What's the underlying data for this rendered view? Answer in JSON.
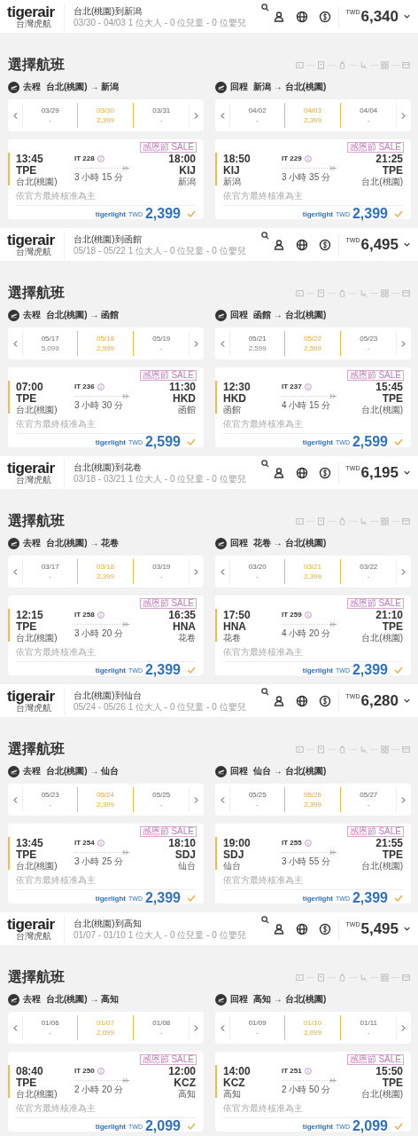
{
  "sections": [
    {
      "header": {
        "logo": "tigerair",
        "logo_subtitle": "台灣虎航",
        "route": "台北(桃園)到新潟",
        "details": "03/30 - 04/03  1 位大人 - 0 位兒童 - 0 位嬰兒",
        "currency": "TWD",
        "total": "6,340"
      },
      "title": "選擇航班",
      "legs": [
        {
          "label": "去程",
          "route": "台北(桃園) → 新潟",
          "dates": [
            {
              "date": "03/29",
              "price": "-",
              "selected": false
            },
            {
              "date": "03/30",
              "price": "2,399",
              "selected": true
            },
            {
              "date": "03/31",
              "price": "-",
              "selected": false
            }
          ],
          "flight": {
            "tag": "感恩節 SALE",
            "depart_time": "13:45",
            "depart_code": "TPE",
            "depart_city": "台北(桃園)",
            "flight_no": "IT 228",
            "duration": "3 小時 15 分",
            "arrive_time": "18:00",
            "arrive_code": "KIJ",
            "arrive_city": "新潟",
            "note": "依官方最終核准為主",
            "fare_brand": "tigerlight",
            "currency": "TWD",
            "price": "2,399",
            "selected": true
          }
        },
        {
          "label": "回程",
          "route": "新潟 → 台北(桃園)",
          "dates": [
            {
              "date": "04/02",
              "price": "-",
              "selected": false
            },
            {
              "date": "04/03",
              "price": "2,399",
              "selected": true
            },
            {
              "date": "04/04",
              "price": "-",
              "selected": false
            }
          ],
          "flight": {
            "tag": "感恩節 SALE",
            "depart_time": "18:50",
            "depart_code": "KIJ",
            "depart_city": "新潟",
            "flight_no": "IT 229",
            "duration": "3 小時 35 分",
            "arrive_time": "21:25",
            "arrive_code": "TPE",
            "arrive_city": "台北(桃園)",
            "note": "依官方最終核准為主",
            "fare_brand": "tigerlight",
            "currency": "TWD",
            "price": "2,399",
            "selected": true
          }
        }
      ]
    },
    {
      "header": {
        "logo": "tigerair",
        "logo_subtitle": "台灣虎航",
        "route": "台北(桃園)到函館",
        "details": "05/18 - 05/22  1 位大人 - 0 位兒童 - 0 位嬰兒",
        "currency": "TWD",
        "total": "6,495"
      },
      "title": "選擇航班",
      "legs": [
        {
          "label": "去程",
          "route": "台北(桃園) → 函館",
          "dates": [
            {
              "date": "05/17",
              "price": "5,099",
              "selected": false
            },
            {
              "date": "05/18",
              "price": "2,599",
              "selected": true
            },
            {
              "date": "05/19",
              "price": "-",
              "selected": false
            }
          ],
          "flight": {
            "tag": "感恩節 SALE",
            "depart_time": "07:00",
            "depart_code": "TPE",
            "depart_city": "台北(桃園)",
            "flight_no": "IT 236",
            "duration": "3 小時 30 分",
            "arrive_time": "11:30",
            "arrive_code": "HKD",
            "arrive_city": "函館",
            "note": "依官方最終核准為主",
            "fare_brand": "tigerlight",
            "currency": "TWD",
            "price": "2,599",
            "selected": true
          }
        },
        {
          "label": "回程",
          "route": "函館 → 台北(桃園)",
          "dates": [
            {
              "date": "05/21",
              "price": "2,599",
              "selected": false
            },
            {
              "date": "05/22",
              "price": "2,599",
              "selected": true
            },
            {
              "date": "05/23",
              "price": "-",
              "selected": false
            }
          ],
          "flight": {
            "tag": "感恩節 SALE",
            "depart_time": "12:30",
            "depart_code": "HKD",
            "depart_city": "函館",
            "flight_no": "IT 237",
            "duration": "4 小時 15 分",
            "arrive_time": "15:45",
            "arrive_code": "TPE",
            "arrive_city": "台北(桃園)",
            "note": "依官方最終核准為主",
            "fare_brand": "tigerlight",
            "currency": "TWD",
            "price": "2,599",
            "selected": true
          }
        }
      ]
    },
    {
      "header": {
        "logo": "tigerair",
        "logo_subtitle": "台灣虎航",
        "route": "台北(桃園)到花卷",
        "details": "03/18 - 03/21  1 位大人 - 0 位兒童 - 0 位嬰兒",
        "currency": "TWD",
        "total": "6,195"
      },
      "title": "選擇航班",
      "legs": [
        {
          "label": "去程",
          "route": "台北(桃園) → 花卷",
          "dates": [
            {
              "date": "03/17",
              "price": "-",
              "selected": false
            },
            {
              "date": "03/18",
              "price": "2,399",
              "selected": true
            },
            {
              "date": "03/19",
              "price": "-",
              "selected": false
            }
          ],
          "flight": {
            "tag": "感恩節 SALE",
            "depart_time": "12:15",
            "depart_code": "TPE",
            "depart_city": "台北(桃園)",
            "flight_no": "IT 258",
            "duration": "3 小時 20 分",
            "arrive_time": "16:35",
            "arrive_code": "HNA",
            "arrive_city": "花卷",
            "note": "依官方最終核准為主",
            "fare_brand": "tigerlight",
            "currency": "TWD",
            "price": "2,399",
            "selected": true
          }
        },
        {
          "label": "回程",
          "route": "花卷 → 台北(桃園)",
          "dates": [
            {
              "date": "03/20",
              "price": "-",
              "selected": false
            },
            {
              "date": "03/21",
              "price": "2,399",
              "selected": true
            },
            {
              "date": "03/22",
              "price": "-",
              "selected": false
            }
          ],
          "flight": {
            "tag": "感恩節 SALE",
            "depart_time": "17:50",
            "depart_code": "HNA",
            "depart_city": "花卷",
            "flight_no": "IT 259",
            "duration": "4 小時 20 分",
            "arrive_time": "21:10",
            "arrive_code": "TPE",
            "arrive_city": "台北(桃園)",
            "note": "依官方最終核准為主",
            "fare_brand": "tigerlight",
            "currency": "TWD",
            "price": "2,399",
            "selected": true
          }
        }
      ]
    },
    {
      "header": {
        "logo": "tigerair",
        "logo_subtitle": "台灣虎航",
        "route": "台北(桃園)到仙台",
        "details": "05/24 - 05/26  1 位大人 - 0 位兒童 - 0 位嬰兒",
        "currency": "TWD",
        "total": "6,280"
      },
      "title": "選擇航班",
      "legs": [
        {
          "label": "去程",
          "route": "台北(桃園) → 仙台",
          "dates": [
            {
              "date": "05/23",
              "price": "-",
              "selected": false
            },
            {
              "date": "05/24",
              "price": "2,399",
              "selected": true
            },
            {
              "date": "05/25",
              "price": "-",
              "selected": false
            }
          ],
          "flight": {
            "tag": "感恩節 SALE",
            "depart_time": "13:45",
            "depart_code": "TPE",
            "depart_city": "台北(桃園)",
            "flight_no": "IT 254",
            "duration": "3 小時 25 分",
            "arrive_time": "18:10",
            "arrive_code": "SDJ",
            "arrive_city": "仙台",
            "note": "依官方最終核准為主",
            "fare_brand": "tigerlight",
            "currency": "TWD",
            "price": "2,399",
            "selected": true
          }
        },
        {
          "label": "回程",
          "route": "仙台 → 台北(桃園)",
          "dates": [
            {
              "date": "05/25",
              "price": "-",
              "selected": false
            },
            {
              "date": "05/26",
              "price": "2,399",
              "selected": true
            },
            {
              "date": "05/27",
              "price": "-",
              "selected": false
            }
          ],
          "flight": {
            "tag": "感恩節 SALE",
            "depart_time": "19:00",
            "depart_code": "SDJ",
            "depart_city": "仙台",
            "flight_no": "IT 255",
            "duration": "3 小時 55 分",
            "arrive_time": "21:55",
            "arrive_code": "TPE",
            "arrive_city": "台北(桃園)",
            "note": "依官方最終核准為主",
            "fare_brand": "tigerlight",
            "currency": "TWD",
            "price": "2,399",
            "selected": true
          }
        }
      ]
    },
    {
      "header": {
        "logo": "tigerair",
        "logo_subtitle": "台灣虎航",
        "route": "台北(桃園)到高知",
        "details": "01/07 - 01/10  1 位大人 - 0 位兒童 - 0 位嬰兒",
        "currency": "TWD",
        "total": "5,495"
      },
      "title": "選擇航班",
      "legs": [
        {
          "label": "去程",
          "route": "台北(桃園) → 高知",
          "dates": [
            {
              "date": "01/06",
              "price": "-",
              "selected": false
            },
            {
              "date": "01/07",
              "price": "2,099",
              "selected": true
            },
            {
              "date": "01/08",
              "price": "-",
              "selected": false
            }
          ],
          "flight": {
            "tag": "感恩節 SALE",
            "depart_time": "08:40",
            "depart_code": "TPE",
            "depart_city": "台北(桃園)",
            "flight_no": "IT 250",
            "duration": "2 小時 20 分",
            "arrive_time": "12:00",
            "arrive_code": "KCZ",
            "arrive_city": "高知",
            "note": "依官方最終核准為主",
            "fare_brand": "tigerlight",
            "currency": "TWD",
            "price": "2,099",
            "selected": true
          }
        },
        {
          "label": "回程",
          "route": "高知 → 台北(桃園)",
          "dates": [
            {
              "date": "01/09",
              "price": "-",
              "selected": false
            },
            {
              "date": "01/10",
              "price": "2,099",
              "selected": true
            },
            {
              "date": "01/11",
              "price": "-",
              "selected": false
            }
          ],
          "flight": {
            "tag": "感恩節 SALE",
            "depart_time": "14:00",
            "depart_code": "KCZ",
            "depart_city": "高知",
            "flight_no": "IT 251",
            "duration": "2 小時 50 分",
            "arrive_time": "15:50",
            "arrive_code": "TPE",
            "arrive_city": "台北(桃園)",
            "note": "依官方最終核准為主",
            "fare_brand": "tigerlight",
            "currency": "TWD",
            "price": "2,099",
            "selected": true
          }
        }
      ]
    }
  ]
}
